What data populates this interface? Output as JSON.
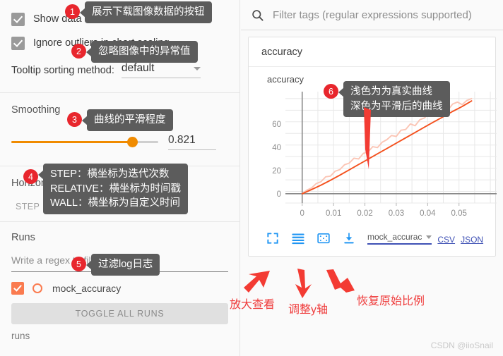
{
  "sidebar": {
    "checkbox_show_download": "Show data download links",
    "checkbox_ignore_outliers": "Ignore outliers in chart scaling",
    "tooltip_sort_label": "Tooltip sorting method:",
    "tooltip_sort_value": "default",
    "smoothing_label": "Smoothing",
    "smoothing_value": "0.821",
    "horizontal_axis_label": "Horizontal Axis",
    "axis_tabs": [
      "STEP",
      "RELATIVE",
      "WALL"
    ],
    "runs_label": "Runs",
    "runs_filter_placeholder": "Write a regex to filter runs",
    "run_items": [
      {
        "name": "mock_accuracy"
      }
    ],
    "toggle_all_runs": "TOGGLE ALL RUNS",
    "runs_footer": "runs"
  },
  "right": {
    "filter_placeholder": "Filter tags (regular expressions supported)",
    "tag_group": "accuracy",
    "chart_title": "accuracy",
    "toolbar_icons": [
      "expand-icon",
      "y-axis-icon",
      "reset-aspect-icon",
      "download-icon"
    ],
    "download_run": "mock_accurac",
    "download_csv": "CSV",
    "download_json": "JSON"
  },
  "callouts": [
    {
      "num": "1",
      "text": "展示下载图像数据的按钮"
    },
    {
      "num": "2",
      "text": "忽略图像中的异常值"
    },
    {
      "num": "3",
      "text": "曲线的平滑程度"
    },
    {
      "num": "4",
      "text": "STEP：横坐标为迭代次数\nRELATIVE：横坐标为时间戳\nWALL：横坐标为自定义时间"
    },
    {
      "num": "5",
      "text": "过滤log日志"
    },
    {
      "num": "6",
      "text": "浅色为为真实曲线\n深色为平滑后的曲线"
    }
  ],
  "red_notes": [
    {
      "text": "放大查看"
    },
    {
      "text": "调整y轴"
    },
    {
      "text": "恢复原始比例"
    }
  ],
  "watermark": "CSDN @iioSnail",
  "colors": {
    "accent_orange": "#f08b00",
    "run_orange": "#fa7b4f",
    "curve_smoothed": "#f4511e",
    "curve_raw": "#fbc5b5",
    "link_blue": "#3f51b5",
    "icon_blue": "#2196f3",
    "badge_red": "#e8262d",
    "note_red": "#ef3b3b",
    "callout_bg": "#5c5c5c"
  },
  "chart_data": {
    "type": "line",
    "title": "accuracy",
    "xlabel": "",
    "ylabel": "",
    "xlim": [
      -0.004,
      0.062
    ],
    "ylim": [
      -8,
      88
    ],
    "xticks": [
      0,
      0.01,
      0.02,
      0.03,
      0.04,
      0.05
    ],
    "xtick_labels": [
      "0",
      "0.01",
      "0.02",
      "0.03",
      "0.04",
      "0.05"
    ],
    "yticks": [
      0,
      20,
      40,
      60
    ],
    "ytick_labels": [
      "0",
      "20",
      "40",
      "60"
    ],
    "grid": true,
    "legend": "none",
    "series": [
      {
        "name": "mock_accuracy (raw)",
        "color": "#fbc5b5",
        "x": [
          0,
          0.0015,
          0.003,
          0.0045,
          0.006,
          0.0075,
          0.009,
          0.0105,
          0.012,
          0.0135,
          0.015,
          0.0165,
          0.018,
          0.0195,
          0.021,
          0.0225,
          0.024,
          0.0255,
          0.027,
          0.0285,
          0.03,
          0.0315,
          0.033,
          0.0345,
          0.036,
          0.0375,
          0.039,
          0.0405,
          0.042,
          0.0435,
          0.045,
          0.0465,
          0.048,
          0.0495,
          0.051,
          0.0525,
          0.054
        ],
        "y": [
          0,
          3.2,
          5.0,
          8.8,
          10.4,
          14.6,
          15.2,
          19.4,
          20.8,
          25.0,
          26.4,
          30.6,
          30.0,
          34.8,
          36.0,
          40.6,
          39.8,
          44.4,
          46.6,
          50.2,
          49.4,
          54.8,
          55.4,
          60.2,
          58.6,
          63.8,
          65.4,
          69.6,
          68.0,
          73.4,
          74.6,
          72.2,
          77.4,
          79.0,
          76.8,
          80.4,
          82.0
        ]
      },
      {
        "name": "mock_accuracy (smoothed)",
        "color": "#f4511e",
        "x": [
          0,
          0.003,
          0.006,
          0.009,
          0.012,
          0.015,
          0.018,
          0.021,
          0.024,
          0.027,
          0.03,
          0.033,
          0.036,
          0.039,
          0.042,
          0.045,
          0.048,
          0.051,
          0.054
        ],
        "y": [
          0,
          3.6,
          7.4,
          11.6,
          16.0,
          20.6,
          25.2,
          29.8,
          34.4,
          39.0,
          43.6,
          48.2,
          52.8,
          57.4,
          62.0,
          66.4,
          71.0,
          75.2,
          80.0
        ]
      }
    ]
  }
}
